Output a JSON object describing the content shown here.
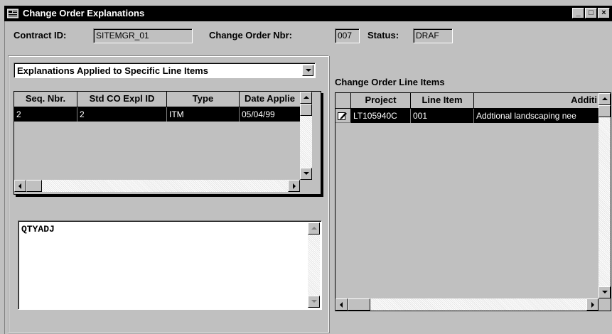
{
  "window": {
    "title": "Change Order Explanations",
    "minimize_glyph": "_",
    "maximize_glyph": "□",
    "close_glyph": "×"
  },
  "header": {
    "contract_id_label": "Contract ID:",
    "contract_id_value": "SITEMGR_01",
    "change_order_label": "Change Order Nbr:",
    "change_order_value": "007",
    "status_label": "Status:",
    "status_value": "DRAF"
  },
  "explanations": {
    "dropdown_value": "Explanations Applied to Specific Line Items",
    "columns": [
      "Seq. Nbr.",
      "Std CO Expl ID",
      "Type",
      "Date Applie"
    ],
    "rows": [
      [
        "2",
        "2",
        "ITM",
        "05/04/99"
      ]
    ],
    "memo_text": "QTYADJ"
  },
  "line_items": {
    "title": "Change Order Line Items",
    "columns": [
      "Project",
      "Line Item",
      "Additi"
    ],
    "rows": [
      [
        "LT105940C",
        "001",
        "Addtional landscaping nee"
      ]
    ]
  },
  "icons": {
    "window_icon": "app-window-icon",
    "row_indicator": "pencil-icon"
  },
  "colors": {
    "window_bg": "#c0c0c0",
    "titlebar": "#000000",
    "selection": "#000000"
  }
}
